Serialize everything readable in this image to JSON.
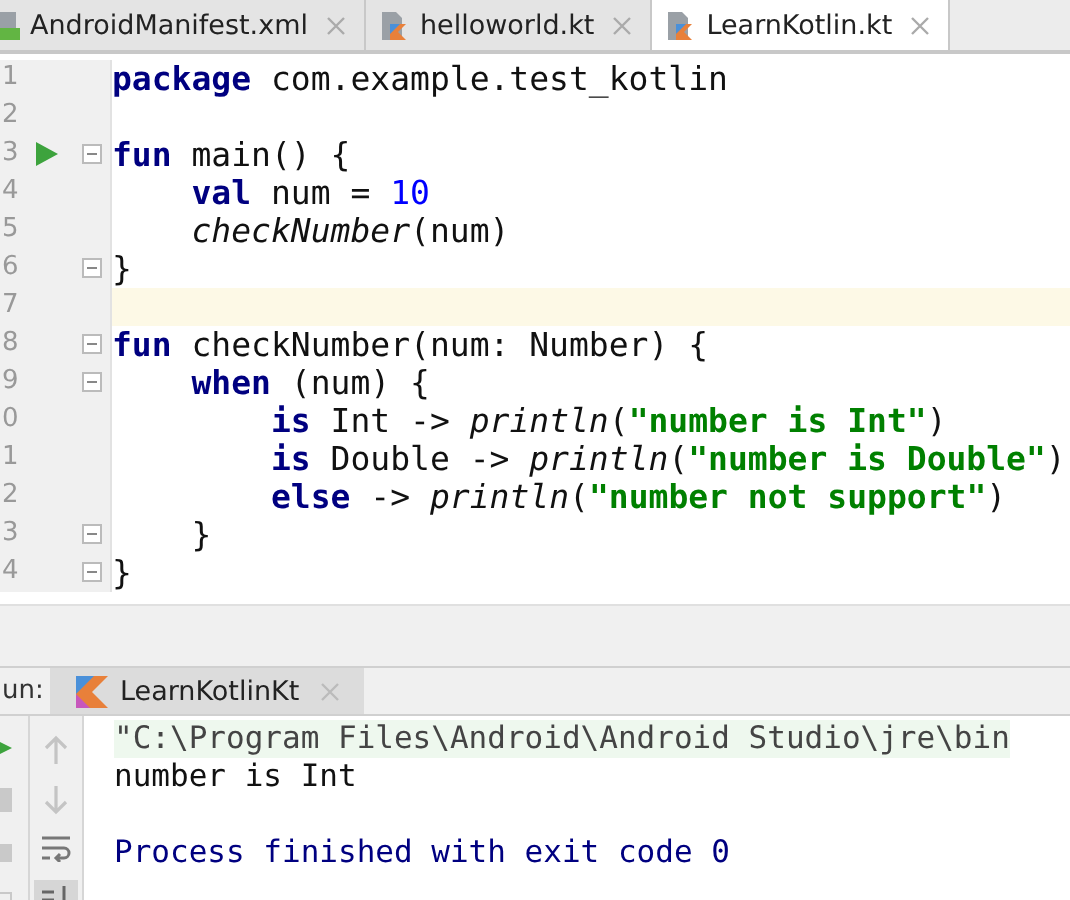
{
  "tabs": [
    {
      "label": "AndroidManifest.xml",
      "kind": "xml",
      "selected": false
    },
    {
      "label": "helloworld.kt",
      "kind": "kotlin",
      "selected": false
    },
    {
      "label": "LearnKotlin.kt",
      "kind": "kotlin",
      "selected": true
    }
  ],
  "editor": {
    "lines": [
      {
        "number": "1",
        "current": false,
        "tokens": [
          {
            "text": "package",
            "kind": "keyword"
          },
          {
            "text": " com.example.test_kotlin",
            "kind": "plain"
          }
        ]
      },
      {
        "number": "2",
        "current": false
      },
      {
        "number": "3",
        "runnable": true,
        "fold": true,
        "current": false,
        "tokens": [
          {
            "text": "fun",
            "kind": "keyword"
          },
          {
            "text": " main() {",
            "kind": "plain"
          }
        ]
      },
      {
        "number": "4",
        "current": false,
        "tokens": [
          {
            "text": "    val",
            "kind": "keyword"
          },
          {
            "text": " num = ",
            "kind": "plain"
          },
          {
            "text": "10",
            "kind": "number"
          }
        ]
      },
      {
        "number": "5",
        "current": false,
        "tokens": [
          {
            "text": "    checkNumber",
            "kind": "call"
          },
          {
            "text": "(num)",
            "kind": "plain"
          }
        ]
      },
      {
        "number": "6",
        "fold": true,
        "current": false,
        "tokens": [
          {
            "text": "}",
            "kind": "plain"
          }
        ]
      },
      {
        "number": "7",
        "current": true
      },
      {
        "number": "8",
        "fold": true,
        "current": false,
        "tokens": [
          {
            "text": "fun",
            "kind": "keyword"
          },
          {
            "text": " checkNumber(num: Number) {",
            "kind": "plain"
          }
        ]
      },
      {
        "number": "9",
        "fold": true,
        "current": false,
        "tokens": [
          {
            "text": "    when",
            "kind": "keyword"
          },
          {
            "text": " (num) {",
            "kind": "plain"
          }
        ]
      },
      {
        "number": "0",
        "current": false,
        "tokens": [
          {
            "text": "        is",
            "kind": "keyword"
          },
          {
            "text": " Int -> ",
            "kind": "plain"
          },
          {
            "text": "println",
            "kind": "call"
          },
          {
            "text": "(",
            "kind": "plain"
          },
          {
            "text": "\"number is Int\"",
            "kind": "string"
          },
          {
            "text": ")",
            "kind": "plain"
          }
        ]
      },
      {
        "number": "1",
        "current": false,
        "tokens": [
          {
            "text": "        is",
            "kind": "keyword"
          },
          {
            "text": " Double -> ",
            "kind": "plain"
          },
          {
            "text": "println",
            "kind": "call"
          },
          {
            "text": "(",
            "kind": "plain"
          },
          {
            "text": "\"number is Double\"",
            "kind": "string"
          },
          {
            "text": ")",
            "kind": "plain"
          }
        ]
      },
      {
        "number": "2",
        "current": false,
        "tokens": [
          {
            "text": "        else",
            "kind": "keyword"
          },
          {
            "text": " -> ",
            "kind": "plain"
          },
          {
            "text": "println",
            "kind": "call"
          },
          {
            "text": "(",
            "kind": "plain"
          },
          {
            "text": "\"number not support\"",
            "kind": "string"
          },
          {
            "text": ")",
            "kind": "plain"
          }
        ]
      },
      {
        "number": "3",
        "fold": true,
        "current": false,
        "tokens": [
          {
            "text": "    }",
            "kind": "plain"
          }
        ]
      },
      {
        "number": "4",
        "fold": true,
        "current": false,
        "tokens": [
          {
            "text": "}",
            "kind": "plain"
          }
        ]
      }
    ]
  },
  "run_panel": {
    "label": "un:",
    "tabs": [
      {
        "label": "LearnKotlinKt",
        "selected": true
      }
    ],
    "console": [
      {
        "text": "\"C:\\Program Files\\Android\\Android Studio\\jre\\bin",
        "kind": "command"
      },
      {
        "text": "number is Int",
        "kind": "output"
      },
      {
        "text": "Process finished with exit code 0",
        "kind": "process"
      }
    ]
  }
}
